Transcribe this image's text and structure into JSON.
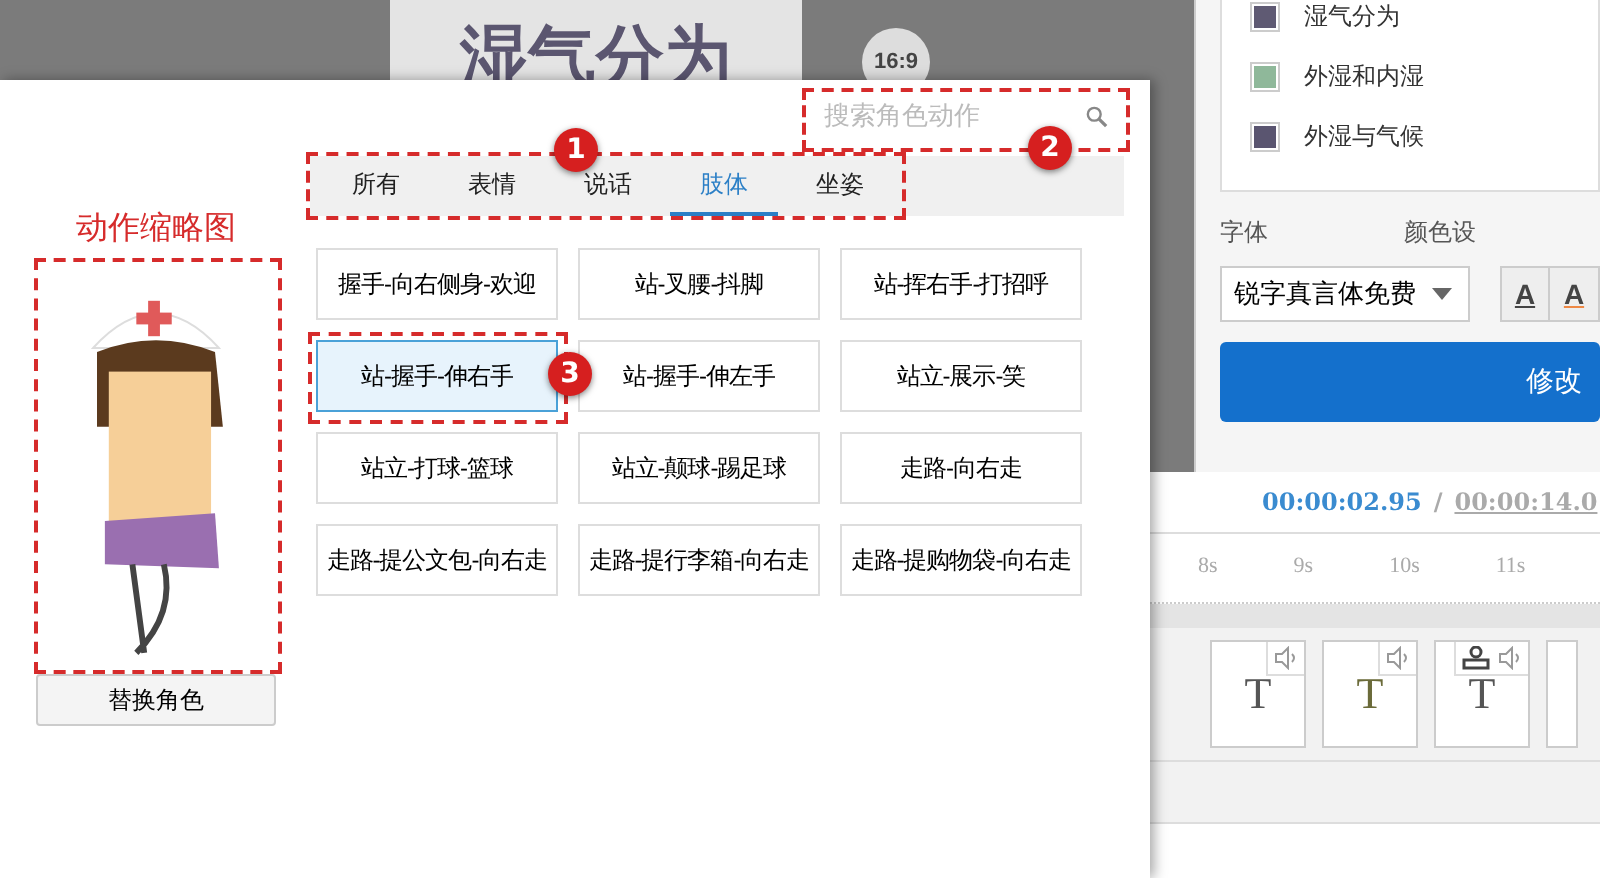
{
  "slide": {
    "title": "湿气分为",
    "ratio_button": "16:9"
  },
  "layers": [
    {
      "name": "湿气分为",
      "color": "#5f5a73"
    },
    {
      "name": "外湿和内湿",
      "color": "#8fb89a"
    },
    {
      "name": "外湿与气候",
      "color": "#5a5570"
    }
  ],
  "font_label": "字体",
  "color_label": "颜色设",
  "font_select": "锐字真言体免费",
  "color_buttons": [
    "A",
    "A"
  ],
  "apply_button": "修改",
  "timeline": {
    "current": "00:00:02.95",
    "separator": "/",
    "total": "00:00:14.0",
    "ticks": [
      "8s",
      "9s",
      "10s",
      "11s"
    ],
    "clips": [
      {
        "label": "T",
        "color": "#555555",
        "figure": false
      },
      {
        "label": "T",
        "color": "#6b6b3a",
        "figure": false
      },
      {
        "label": "T",
        "color": "#555555",
        "figure": true
      }
    ]
  },
  "dialog": {
    "thumbnail_label": "动作缩略图",
    "replace_button": "替换角色",
    "search": {
      "placeholder": "搜索角色动作"
    },
    "tabs": [
      {
        "label": "所有",
        "selected": false
      },
      {
        "label": "表情",
        "selected": false
      },
      {
        "label": "说话",
        "selected": false
      },
      {
        "label": "肢体",
        "selected": true
      },
      {
        "label": "坐姿",
        "selected": false
      }
    ],
    "actions": [
      {
        "label": "握手-向右侧身-欢迎",
        "selected": false
      },
      {
        "label": "站-叉腰-抖脚",
        "selected": false
      },
      {
        "label": "站-挥右手-打招呼",
        "selected": false
      },
      {
        "label": "站-握手-伸右手",
        "selected": true
      },
      {
        "label": "站-握手-伸左手",
        "selected": false
      },
      {
        "label": "站立-展示-笑",
        "selected": false
      },
      {
        "label": "站立-打球-篮球",
        "selected": false
      },
      {
        "label": "站立-颠球-踢足球",
        "selected": false
      },
      {
        "label": "走路-向右走",
        "selected": false
      },
      {
        "label": "走路-提公文包-向右走",
        "selected": false
      },
      {
        "label": "走路-提行李箱-向右走",
        "selected": false
      },
      {
        "label": "走路-提购物袋-向右走",
        "selected": false
      }
    ]
  },
  "callouts": [
    "1",
    "2",
    "3"
  ]
}
